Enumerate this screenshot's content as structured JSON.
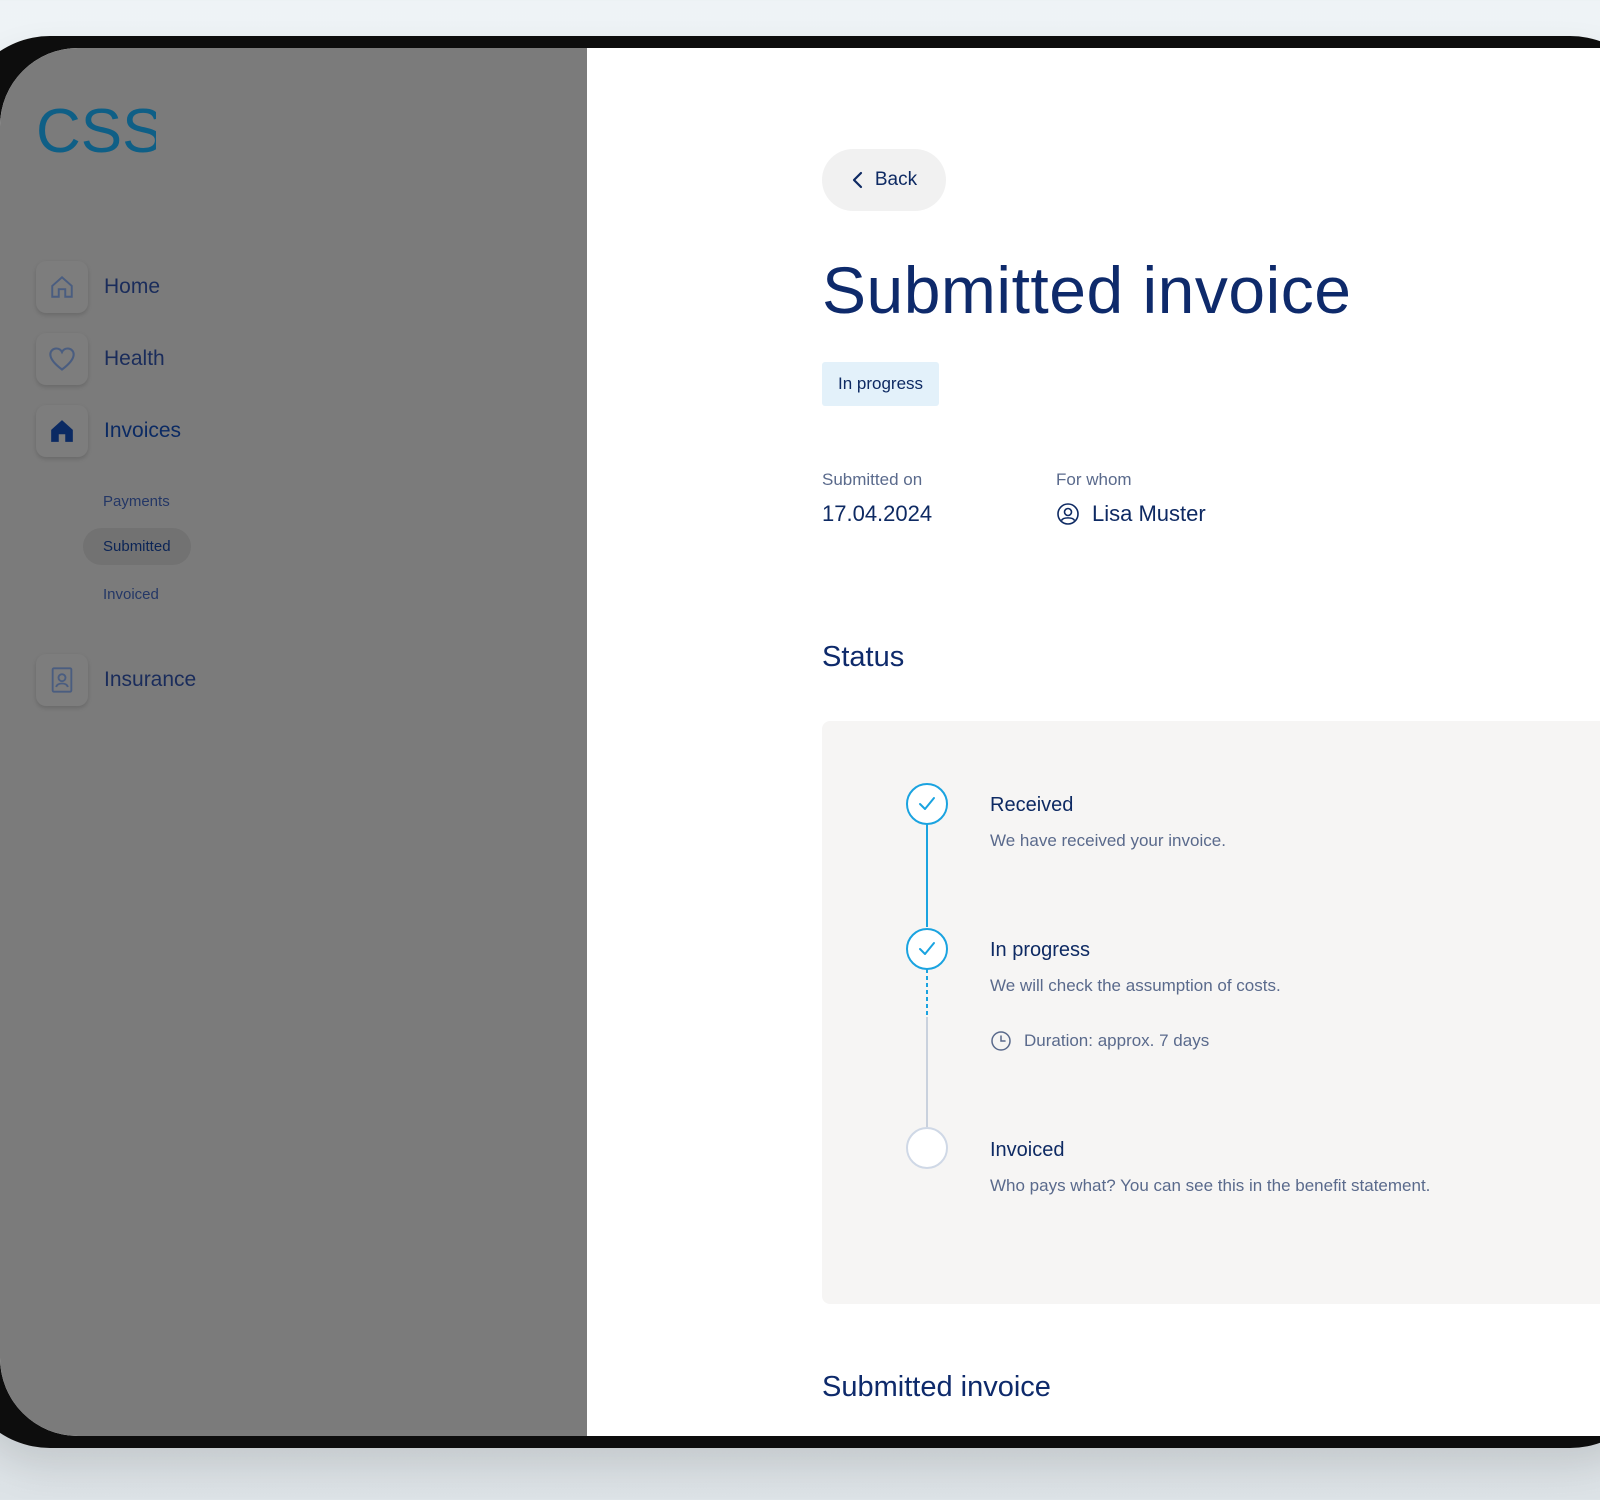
{
  "brand": {
    "logo_text": "CSS",
    "color": "#0f5f86"
  },
  "sidebar": {
    "items": [
      {
        "label": "Home",
        "icon": "home-icon"
      },
      {
        "label": "Health",
        "icon": "heart-icon"
      },
      {
        "label": "Invoices",
        "icon": "home-filled-icon",
        "active": true
      },
      {
        "label": "Insurance",
        "icon": "id-card-icon"
      }
    ],
    "subitems": [
      {
        "label": "Payments"
      },
      {
        "label": "Submitted",
        "active": true
      },
      {
        "label": "Invoiced"
      }
    ]
  },
  "main": {
    "back_label": "Back",
    "title": "Submitted invoice",
    "status_badge": "In progress",
    "submitted_on_label": "Submitted on",
    "submitted_on_value": "17.04.2024",
    "for_whom_label": "For whom",
    "for_whom_value": "Lisa Muster",
    "status_heading": "Status",
    "steps": [
      {
        "title": "Received",
        "desc": "We have received your invoice.",
        "state": "done"
      },
      {
        "title": "In progress",
        "desc": "We will check the assumption of costs.",
        "duration": "Duration: approx. 7 days",
        "state": "done"
      },
      {
        "title": "Invoiced",
        "desc": "Who pays what? You can see this in the benefit statement.",
        "state": "pending"
      }
    ],
    "section2_heading": "Submitted invoice"
  },
  "colors": {
    "accent": "#1aa3e0",
    "navy": "#0e2a63",
    "sidebar_overlay": "#7b7b7b",
    "badge_bg": "#e3f1fa"
  }
}
